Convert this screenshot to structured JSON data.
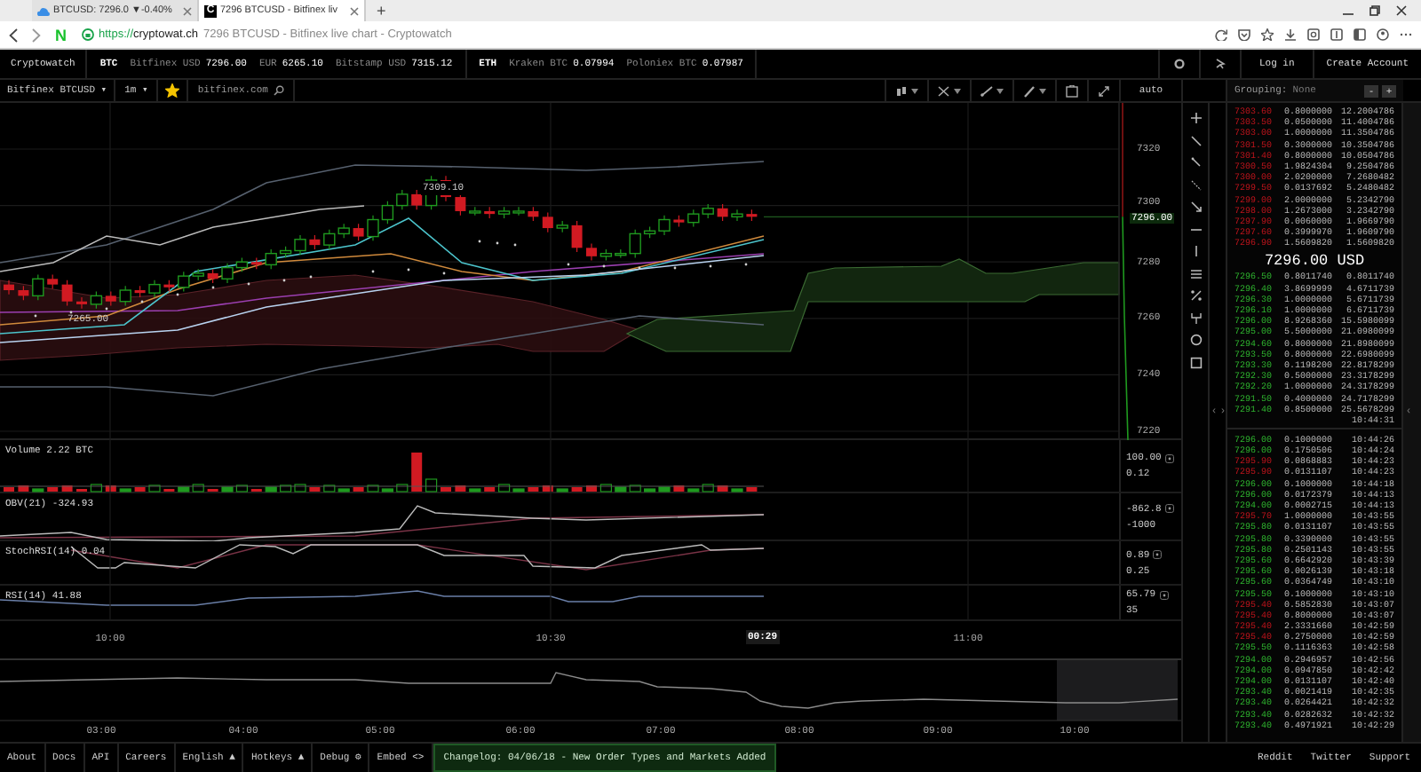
{
  "browser": {
    "tabs": [
      {
        "label": "BTCUSD: 7296.0 ▼-0.40%",
        "kind": "cloud",
        "selected": false
      },
      {
        "label": "7296 BTCUSD - Bitfinex liv",
        "kind": "letter",
        "favicon_text": "C",
        "selected": true
      }
    ],
    "new_tab": "+",
    "logo_text": "N",
    "url_scheme": "https://",
    "url_host": "cryptowat.ch",
    "page_title": "7296 BTCUSD - Bitfinex live chart - Cryptowatch"
  },
  "header": {
    "brand": "Cryptowatch",
    "groups": [
      {
        "asset": "BTC",
        "quotes": [
          {
            "label": "Bitfinex USD",
            "value": "7296.00"
          },
          {
            "label": "EUR",
            "value": "6265.10"
          },
          {
            "label": "Bitstamp USD",
            "value": "7315.12"
          }
        ]
      },
      {
        "asset": "ETH",
        "quotes": [
          {
            "label": "Kraken BTC",
            "value": "0.07994"
          },
          {
            "label": "Poloniex BTC",
            "value": "0.07987"
          }
        ]
      }
    ],
    "login": "Log in",
    "create_account": "Create Account"
  },
  "toolbar": {
    "market": "Bitfinex BTCUSD ▾",
    "interval": "1m ▾",
    "starred": true,
    "exchange_link": "bitfinex.com",
    "scale": "auto"
  },
  "chart": {
    "price_labels": [
      "7320",
      "7300",
      "7280",
      "7260",
      "7240",
      "7220"
    ],
    "current_price": "7296.00",
    "high_label": "7309.10",
    "low_label": "7265.00",
    "time_labels": [
      "10:00",
      "10:30",
      "11:00"
    ],
    "current_time": "00:29"
  },
  "indicators": [
    {
      "kind": "volume",
      "label": "Volume",
      "value": "2.22 BTC",
      "axis": [
        {
          "text": "100.00",
          "menu": true
        },
        {
          "text": "0.12",
          "menu": false
        }
      ]
    },
    {
      "kind": "obv",
      "label": "OBV(21)",
      "value": "-324.93",
      "axis": [
        {
          "text": "-862.8",
          "menu": true
        },
        {
          "text": "-1000",
          "menu": false
        }
      ]
    },
    {
      "kind": "stoch",
      "label": "StochRSI(14)",
      "value": "0.04",
      "axis": [
        {
          "text": "0.89",
          "menu": true
        },
        {
          "text": "0.25",
          "menu": false
        }
      ]
    },
    {
      "kind": "rsi",
      "label": "RSI(14)",
      "value": "41.88",
      "axis": [
        {
          "text": "65.79",
          "menu": true
        },
        {
          "text": "35",
          "menu": false
        }
      ]
    }
  ],
  "overview": {
    "time_labels": [
      "03:00",
      "04:00",
      "05:00",
      "06:00",
      "07:00",
      "08:00",
      "09:00",
      "10:00"
    ]
  },
  "order_book": {
    "grouping_label": "Grouping:",
    "grouping_value": "None",
    "buttons": [
      "-",
      "+"
    ],
    "asks": [
      {
        "price": "7303.60",
        "amount": "0.8000000",
        "total": "12.2004786"
      },
      {
        "price": "7303.50",
        "amount": "0.0500000",
        "total": "11.4004786"
      },
      {
        "price": "7303.00",
        "amount": "1.0000000",
        "total": "11.3504786"
      },
      {
        "price": "7301.50",
        "amount": "0.3000000",
        "total": "10.3504786"
      },
      {
        "price": "7301.40",
        "amount": "0.8000000",
        "total": "10.0504786"
      },
      {
        "price": "7300.50",
        "amount": "1.9824304",
        "total": "9.2504786"
      },
      {
        "price": "7300.00",
        "amount": "2.0200000",
        "total": "7.2680482"
      },
      {
        "price": "7299.50",
        "amount": "0.0137692",
        "total": "5.2480482"
      },
      {
        "price": "7299.00",
        "amount": "2.0000000",
        "total": "5.2342790"
      },
      {
        "price": "7298.00",
        "amount": "1.2673000",
        "total": "3.2342790"
      },
      {
        "price": "7297.90",
        "amount": "0.0060000",
        "total": "1.9669790"
      },
      {
        "price": "7297.60",
        "amount": "0.3999970",
        "total": "1.9609790"
      },
      {
        "price": "7296.90",
        "amount": "1.5609820",
        "total": "1.5609820"
      }
    ],
    "mid_price": "7296.00 USD",
    "bids": [
      {
        "price": "7296.50",
        "amount": "0.8011740",
        "total": "0.8011740"
      },
      {
        "price": "7296.40",
        "amount": "3.8699999",
        "total": "4.6711739"
      },
      {
        "price": "7296.30",
        "amount": "1.0000000",
        "total": "5.6711739"
      },
      {
        "price": "7296.10",
        "amount": "1.0000000",
        "total": "6.6711739"
      },
      {
        "price": "7296.00",
        "amount": "8.9268360",
        "total": "15.5980099"
      },
      {
        "price": "7295.00",
        "amount": "5.5000000",
        "total": "21.0980099"
      },
      {
        "price": "7294.60",
        "amount": "0.8000000",
        "total": "21.8980099"
      },
      {
        "price": "7293.50",
        "amount": "0.8000000",
        "total": "22.6980099"
      },
      {
        "price": "7293.30",
        "amount": "0.1198200",
        "total": "22.8178299"
      },
      {
        "price": "7292.30",
        "amount": "0.5000000",
        "total": "23.3178299"
      },
      {
        "price": "7292.20",
        "amount": "1.0000000",
        "total": "24.3178299"
      },
      {
        "price": "7291.50",
        "amount": "0.4000000",
        "total": "24.7178299"
      },
      {
        "price": "7291.40",
        "amount": "0.8500000",
        "total": "25.5678299"
      }
    ],
    "partial_time": "10:44:31",
    "panel_toggle": [
      "‹",
      "›"
    ],
    "scroll_toggle": "‹"
  },
  "trades": [
    {
      "kind": "buy",
      "price": "7296.00",
      "amount": "0.1000000",
      "time": "10:44:26"
    },
    {
      "kind": "buy",
      "price": "7296.00",
      "amount": "0.1750506",
      "time": "10:44:24"
    },
    {
      "kind": "sell",
      "price": "7295.90",
      "amount": "0.0868883",
      "time": "10:44:23"
    },
    {
      "kind": "sell",
      "price": "7295.90",
      "amount": "0.0131107",
      "time": "10:44:23"
    },
    {
      "kind": "buy",
      "price": "7296.00",
      "amount": "0.1000000",
      "time": "10:44:18"
    },
    {
      "kind": "buy",
      "price": "7296.00",
      "amount": "0.0172379",
      "time": "10:44:13"
    },
    {
      "kind": "buy",
      "price": "7294.00",
      "amount": "0.0002715",
      "time": "10:44:13"
    },
    {
      "kind": "sell",
      "price": "7295.70",
      "amount": "1.0000000",
      "time": "10:43:55"
    },
    {
      "kind": "buy",
      "price": "7295.80",
      "amount": "0.0131107",
      "time": "10:43:55"
    },
    {
      "kind": "buy",
      "price": "7295.80",
      "amount": "0.3390000",
      "time": "10:43:55"
    },
    {
      "kind": "buy",
      "price": "7295.80",
      "amount": "0.2501143",
      "time": "10:43:55"
    },
    {
      "kind": "buy",
      "price": "7295.60",
      "amount": "0.6642920",
      "time": "10:43:39"
    },
    {
      "kind": "buy",
      "price": "7295.60",
      "amount": "0.0026139",
      "time": "10:43:18"
    },
    {
      "kind": "buy",
      "price": "7295.60",
      "amount": "0.0364749",
      "time": "10:43:10"
    },
    {
      "kind": "buy",
      "price": "7295.50",
      "amount": "0.1000000",
      "time": "10:43:10"
    },
    {
      "kind": "sell",
      "price": "7295.40",
      "amount": "0.5852830",
      "time": "10:43:07"
    },
    {
      "kind": "sell",
      "price": "7295.40",
      "amount": "0.8000000",
      "time": "10:43:07"
    },
    {
      "kind": "sell",
      "price": "7295.40",
      "amount": "2.3331660",
      "time": "10:42:59"
    },
    {
      "kind": "sell",
      "price": "7295.40",
      "amount": "0.2750000",
      "time": "10:42:59"
    },
    {
      "kind": "buy",
      "price": "7295.50",
      "amount": "0.1116363",
      "time": "10:42:58"
    },
    {
      "kind": "buy",
      "price": "7294.00",
      "amount": "0.2946957",
      "time": "10:42:56"
    },
    {
      "kind": "buy",
      "price": "7294.00",
      "amount": "0.0947850",
      "time": "10:42:42"
    },
    {
      "kind": "buy",
      "price": "7294.00",
      "amount": "0.0131107",
      "time": "10:42:40"
    },
    {
      "kind": "buy",
      "price": "7293.40",
      "amount": "0.0021419",
      "time": "10:42:35"
    },
    {
      "kind": "buy",
      "price": "7293.40",
      "amount": "0.0264421",
      "time": "10:42:32"
    },
    {
      "kind": "buy",
      "price": "7293.40",
      "amount": "0.0282632",
      "time": "10:42:32"
    },
    {
      "kind": "buy",
      "price": "7293.40",
      "amount": "0.4971921",
      "time": "10:42:29"
    }
  ],
  "footer": {
    "links": [
      "About",
      "Docs",
      "API",
      "Careers",
      "English ▲",
      "Hotkeys ▲",
      "Debug ⚙",
      "Embed <>"
    ],
    "changelog": "Changelog: 04/06/18 - New Order Types and Markets Added",
    "right_links": [
      "Reddit",
      "Twitter",
      "Support"
    ]
  }
}
